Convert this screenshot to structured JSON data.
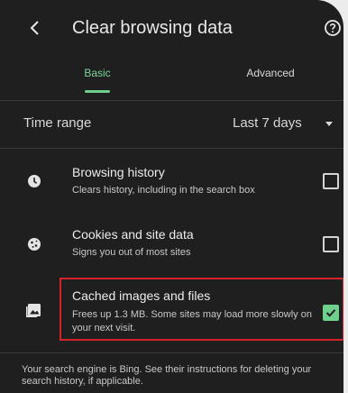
{
  "header": {
    "title": "Clear browsing data",
    "back_icon": "chevron-left-icon",
    "help_icon": "help-circle-icon"
  },
  "tabs": [
    {
      "label": "Basic",
      "selected": true
    },
    {
      "label": "Advanced",
      "selected": false
    }
  ],
  "time_range": {
    "label": "Time range",
    "value": "Last 7 days"
  },
  "options": [
    {
      "title": "Browsing history",
      "subtitle": "Clears history, including in the search box",
      "icon": "clock-icon",
      "checked": false
    },
    {
      "title": "Cookies and site data",
      "subtitle": "Signs you out of most sites",
      "icon": "cookie-icon",
      "checked": false
    },
    {
      "title": "Cached images and files",
      "subtitle": "Frees up 1.3 MB. Some sites may load more slowly on your next visit.",
      "icon": "image-icon",
      "checked": true,
      "highlighted": true
    }
  ],
  "footer": {
    "text": "Your search engine is Bing. See their instructions for deleting your search history, if applicable."
  },
  "colors": {
    "background": "#1f1f1f",
    "accent": "#6fcf8d",
    "highlight_border": "#d6232a"
  }
}
